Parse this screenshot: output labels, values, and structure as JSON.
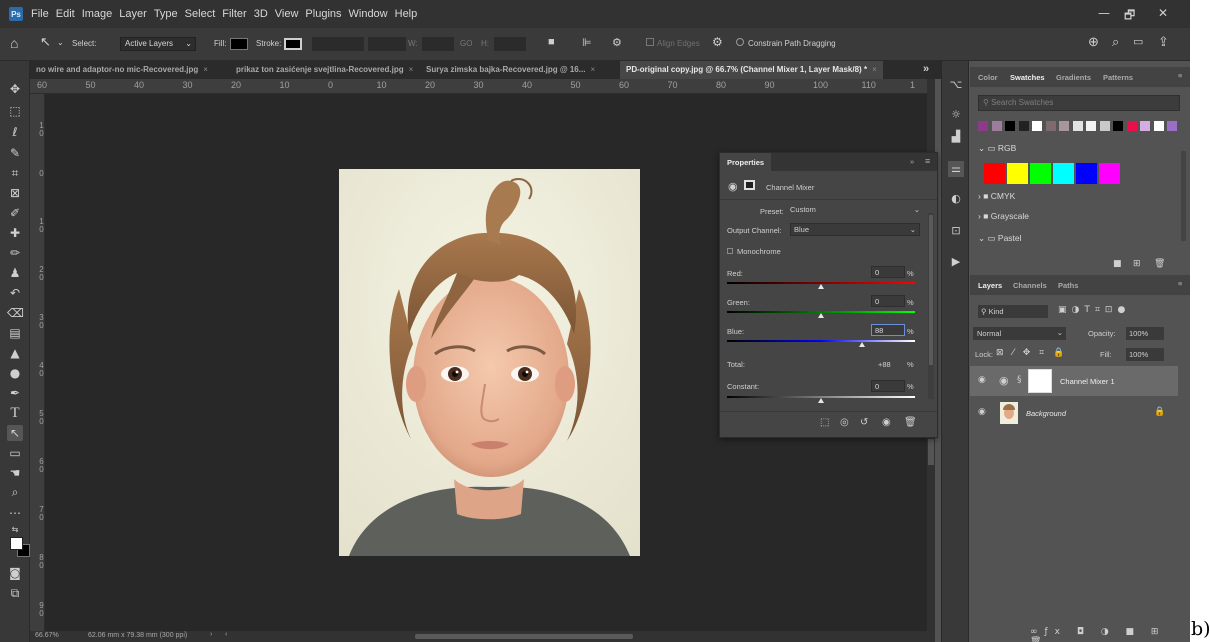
{
  "menubar": {
    "logo": "Ps",
    "items": [
      "File",
      "Edit",
      "Image",
      "Layer",
      "Type",
      "Select",
      "Filter",
      "3D",
      "View",
      "Plugins",
      "Window",
      "Help"
    ],
    "minimize": "—",
    "restore": "🗗",
    "close": "✕"
  },
  "options": {
    "select_label": "Select:",
    "select_value": "Active Layers",
    "fill_label": "Fill:",
    "stroke_label": "Stroke:",
    "w_label": "W:",
    "go_label": "GO",
    "h_label": "H:",
    "align_edges": "Align Edges",
    "constrain": "Constrain Path Dragging"
  },
  "tabs": [
    {
      "label": "no wire and adaptor-no mic-Recovered.jpg",
      "close": "×"
    },
    {
      "label": "prikaz ton zasićenje svejtlina-Recovered.jpg",
      "close": "×"
    },
    {
      "label": "Surya zimska bajka-Recovered.jpg @ 16...",
      "close": "×"
    },
    {
      "label": "PD-original copy.jpg @ 66.7% (Channel Mixer 1, Layer Mask/8) *",
      "close": "×"
    }
  ],
  "tabs_overflow": "»",
  "ruler_top": [
    "60",
    "50",
    "40",
    "30",
    "20",
    "10",
    "0",
    "10",
    "20",
    "30",
    "40",
    "50",
    "60",
    "70",
    "80",
    "90",
    "100",
    "110",
    "1"
  ],
  "ruler_left": [
    "1 0",
    "0",
    "1 0",
    "2 0",
    "3 0",
    "4 0",
    "5 0",
    "6 0",
    "7 0",
    "8 0",
    "9 0"
  ],
  "status": {
    "zoom": "66.67%",
    "doc_info": "62.06 mm x 79.38 mm (300 ppi)",
    "arrow": "›",
    "left_arrow": "‹"
  },
  "properties": {
    "title": "Properties",
    "menu": "≡",
    "adjustment": "Channel Mixer",
    "preset_label": "Preset:",
    "preset_value": "Custom",
    "output_label": "Output Channel:",
    "output_value": "Blue",
    "monochrome": "Monochrome",
    "sliders": [
      {
        "label": "Red:",
        "value": "0",
        "pct": "%",
        "level": 0.5
      },
      {
        "label": "Green:",
        "value": "0",
        "pct": "%",
        "level": 0.5
      },
      {
        "label": "Blue:",
        "value": "88",
        "pct": "%",
        "level": 0.72
      }
    ],
    "total_label": "Total:",
    "total_value": "+88",
    "total_pct": "%",
    "constant_label": "Constant:",
    "constant_value": "0",
    "constant_pct": "%",
    "constant_level": 0.5
  },
  "swatches_panel": {
    "tabs": [
      "Color",
      "Swatches",
      "Gradients",
      "Patterns"
    ],
    "search_placeholder": "Search Swatches",
    "recent": [
      "#8e3a8a",
      "#9c7d9c",
      "#000000",
      "#222222",
      "#ffffff",
      "#7e6b6e",
      "#a8979a",
      "#e3e3e3",
      "#f2f2f2",
      "#c9c9c9",
      "#000000",
      "#e8104b",
      "#d4aee0",
      "#ffffff",
      "#9c6fc6"
    ],
    "folders": [
      {
        "name": "RGB",
        "open": true
      },
      {
        "name": "CMYK",
        "open": false
      },
      {
        "name": "Grayscale",
        "open": false
      },
      {
        "name": "Pastel",
        "open": true
      }
    ],
    "rgb_colors": [
      "#ff0000",
      "#ffff00",
      "#00ff00",
      "#00ffff",
      "#0000ff",
      "#ff00ff"
    ]
  },
  "layers_panel": {
    "tabs": [
      "Layers",
      "Channels",
      "Paths"
    ],
    "kind_label": "Kind",
    "blend_mode": "Normal",
    "opacity_label": "Opacity:",
    "opacity_value": "100%",
    "lock_label": "Lock:",
    "fill_label": "Fill:",
    "fill_value": "100%",
    "layers": [
      {
        "name": "Channel Mixer 1",
        "visible": true,
        "selected": true
      },
      {
        "name": "Background",
        "visible": true,
        "selected": false
      }
    ]
  },
  "suffix_text": "b)"
}
